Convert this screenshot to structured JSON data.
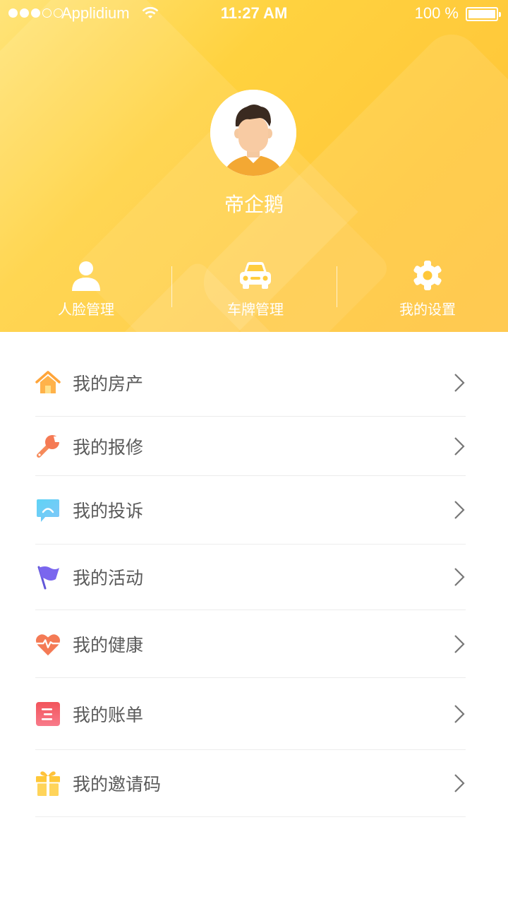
{
  "status_bar": {
    "carrier": "Applidium",
    "time": "11:27 AM",
    "battery_text": "100 %",
    "signal_strength": 3,
    "signal_max": 5
  },
  "profile": {
    "username": "帝企鹅"
  },
  "quick_actions": [
    {
      "label": "人脸管理",
      "icon": "person-icon"
    },
    {
      "label": "车牌管理",
      "icon": "car-icon"
    },
    {
      "label": "我的设置",
      "icon": "gear-icon"
    }
  ],
  "menu": [
    {
      "label": "我的房产",
      "icon": "house-icon",
      "color": "#ffa53a"
    },
    {
      "label": "我的报修",
      "icon": "wrench-icon",
      "color": "#f57a54"
    },
    {
      "label": "我的投诉",
      "icon": "chat-bubble-icon",
      "color": "#4fc3f7"
    },
    {
      "label": "我的活动",
      "icon": "flag-icon",
      "color": "#6c5ce7"
    },
    {
      "label": "我的健康",
      "icon": "heart-pulse-icon",
      "color": "#f26d50"
    },
    {
      "label": "我的账单",
      "icon": "bill-icon",
      "color": "#f2545b"
    },
    {
      "label": "我的邀请码",
      "icon": "gift-icon",
      "color": "#ffc83a"
    }
  ],
  "colors": {
    "header_gradient_start": "#ffe47a",
    "header_gradient_end": "#ffc43f",
    "menu_text": "#5a5a5a",
    "divider": "#ececec"
  }
}
